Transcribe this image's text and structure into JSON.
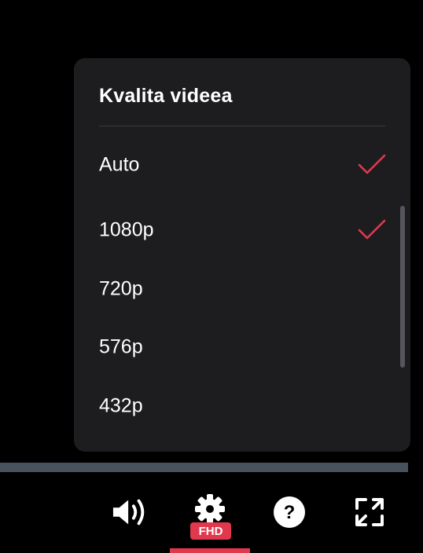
{
  "quality_menu": {
    "title": "Kvalita videea",
    "options": [
      {
        "label": "Auto",
        "checked": true
      },
      {
        "label": "1080p",
        "checked": true
      },
      {
        "label": "720p",
        "checked": false
      },
      {
        "label": "576p",
        "checked": false
      },
      {
        "label": "432p",
        "checked": false
      }
    ]
  },
  "controls": {
    "volume": {
      "icon": "volume-icon"
    },
    "settings": {
      "icon": "gear-icon",
      "badge": "FHD"
    },
    "help": {
      "icon": "help-icon"
    },
    "fullscreen": {
      "icon": "fullscreen-icon"
    }
  },
  "colors": {
    "accent": "#e2384e",
    "panel_bg": "#1d1d20",
    "progress_track": "#47525d"
  }
}
